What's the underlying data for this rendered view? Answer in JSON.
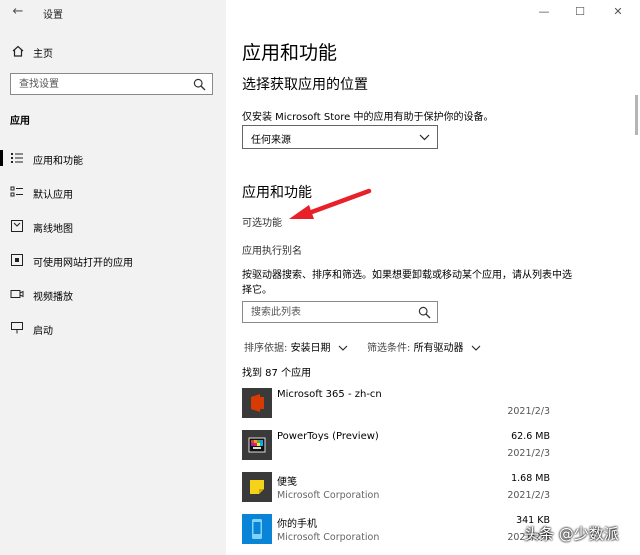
{
  "window": {
    "title": "设置",
    "back_glyph": "←",
    "minimize_glyph": "—",
    "maximize_glyph": "☐",
    "close_glyph": "✕"
  },
  "sidebar": {
    "home_label": "主页",
    "search_placeholder": "查找设置",
    "section_label": "应用",
    "items": [
      {
        "label": "应用和功能",
        "icon": "apps-list-icon",
        "active": true
      },
      {
        "label": "默认应用",
        "icon": "default-apps-icon",
        "active": false
      },
      {
        "label": "离线地图",
        "icon": "offline-maps-icon",
        "active": false
      },
      {
        "label": "可使用网站打开的应用",
        "icon": "apps-for-websites-icon",
        "active": false
      },
      {
        "label": "视频播放",
        "icon": "video-playback-icon",
        "active": false
      },
      {
        "label": "启动",
        "icon": "startup-icon",
        "active": false
      }
    ]
  },
  "main": {
    "title": "应用和功能",
    "install_section": {
      "heading": "选择获取应用的位置",
      "description": "仅安装 Microsoft Store 中的应用有助于保护你的设备。",
      "dropdown_value": "任何来源"
    },
    "apps_section": {
      "heading": "应用和功能",
      "optional_features_link": "可选功能",
      "aliases_link": "应用执行别名",
      "description": "按驱动器搜索、排序和筛选。如果想要卸载或移动某个应用，请从列表中选择它。",
      "search_placeholder": "搜索此列表",
      "sort_key": "排序依据:",
      "sort_value": "安装日期",
      "filter_key": "筛选条件:",
      "filter_value": "所有驱动器",
      "count_text": "找到 87 个应用"
    },
    "apps": [
      {
        "name": "Microsoft 365 - zh-cn",
        "publisher": "",
        "size": "",
        "date": "2021/2/3",
        "icon": "office-icon"
      },
      {
        "name": "PowerToys (Preview)",
        "publisher": "",
        "size": "62.6 MB",
        "date": "2021/2/3",
        "icon": "powertoys-icon"
      },
      {
        "name": "便笺",
        "publisher": "Microsoft Corporation",
        "size": "1.68 MB",
        "date": "2021/2/3",
        "icon": "sticky-notes-icon"
      },
      {
        "name": "你的手机",
        "publisher": "Microsoft Corporation",
        "size": "341 KB",
        "date": "2021/2/3",
        "icon": "your-phone-icon"
      }
    ]
  },
  "watermark": {
    "text": "头条 @少数派"
  },
  "colors": {
    "sidebar_bg": "#f2f2f2",
    "arrow": "#e8202a",
    "office_orange": "#d83b01",
    "sticky_yellow": "#f7d21a",
    "phone_blue": "#0a84d6"
  }
}
